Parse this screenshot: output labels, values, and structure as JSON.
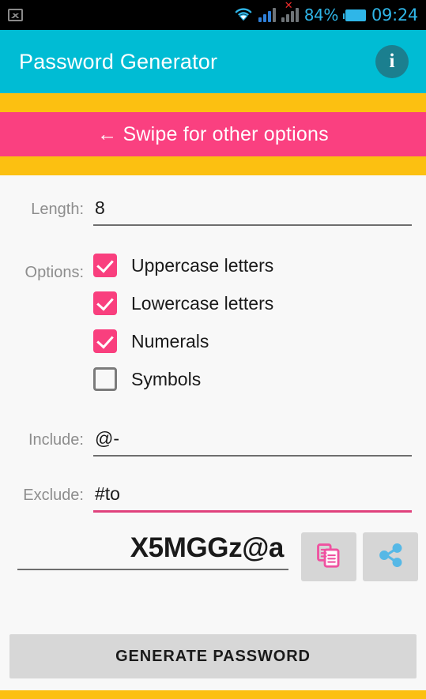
{
  "statusbar": {
    "left_icon": "screenshot-image-icon",
    "wifi_icon": "wifi-icon",
    "signal_sim1_icon": "signal-bars-icon",
    "signal_sim2_icon": "signal-bars-no-sim-icon",
    "no_sim_mark": "✕",
    "battery_percent": "84%",
    "battery_icon": "battery-icon",
    "clock": "09:24",
    "accent_color": "#2fb6e8",
    "background_color": "#000000"
  },
  "appbar": {
    "title": "Password Generator",
    "info_label": "i",
    "info_icon": "info-icon",
    "background_color": "#00bcd4",
    "title_color": "#ffffff",
    "info_bg_color": "#1b7f8f"
  },
  "banner": {
    "text": "←  Swipe for other options",
    "band_color": "#fcc011",
    "banner_color": "#fa4080",
    "text_color": "#ffffff"
  },
  "form": {
    "length": {
      "label": "Length:",
      "value": "8",
      "placeholder": "Length",
      "underline_color": "#6e6e6e"
    },
    "options": {
      "label": "Options:",
      "items": [
        {
          "label": "Uppercase letters",
          "checked": true
        },
        {
          "label": "Lowercase letters",
          "checked": true
        },
        {
          "label": "Numerals",
          "checked": true
        },
        {
          "label": "Symbols",
          "checked": false
        }
      ],
      "checked_color": "#f93f7e",
      "unchecked_color": "#7b7b7b"
    },
    "include": {
      "label": "Include:",
      "value": "@-",
      "placeholder": "Include",
      "underline_color": "#6e6e6e"
    },
    "exclude": {
      "label": "Exclude:",
      "value": "#to",
      "placeholder": "Exclude",
      "underline_color": "#e0427d",
      "focused": true
    }
  },
  "result": {
    "password": "X5MGGz@a",
    "copy_icon": "copy-icon",
    "share_icon": "share-icon",
    "copy_icon_color": "#ef52a0",
    "share_icon_color": "#56b8e6",
    "button_bg_color": "#d6d6d6"
  },
  "generate": {
    "label": "GENERATE PASSWORD",
    "background_color": "#d7d7d7"
  },
  "bottom_band_color": "#fcc011"
}
